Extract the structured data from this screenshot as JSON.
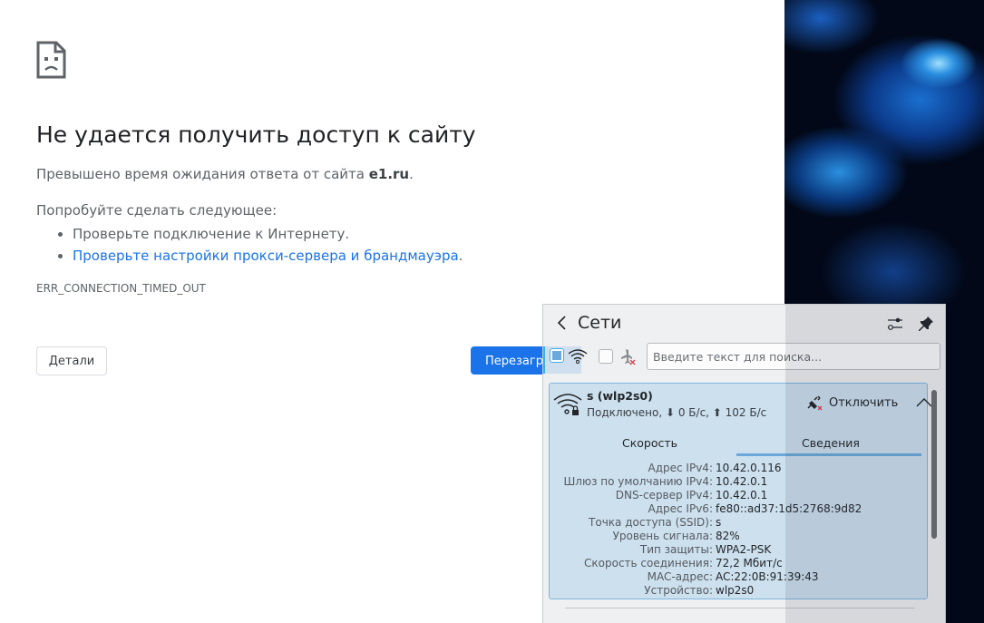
{
  "error_page": {
    "title": "Не удается получить доступ к сайту",
    "message_prefix": "Превышено время ожидания ответа от сайта ",
    "message_host": "e1.ru",
    "message_suffix": ".",
    "try_label": "Попробуйте сделать следующее:",
    "suggestions": [
      "Проверьте подключение к Интернету.",
      "Проверьте настройки прокси-сервера и брандмауэра"
    ],
    "suggestion_suffix": ".",
    "error_code": "ERR_CONNECTION_TIMED_OUT",
    "details_button": "Детали",
    "reload_button": "Перезагрузить"
  },
  "network_panel": {
    "title": "Сети",
    "search_placeholder": "Введите текст для поиска...",
    "wifi_enabled": true,
    "airplane_mode": false,
    "connection": {
      "name": "s (wlp2s0)",
      "status": "Подключено, ⬇ 0 Б/с, ⬆ 102 Б/с",
      "disconnect_label": "Отключить",
      "tabs": [
        "Скорость",
        "Сведения"
      ],
      "active_tab": "Сведения",
      "details": [
        {
          "k": "Адрес IPv4:",
          "v": "10.42.0.116"
        },
        {
          "k": "Шлюз по умолчанию IPv4:",
          "v": "10.42.0.1"
        },
        {
          "k": "DNS-сервер IPv4:",
          "v": "10.42.0.1"
        },
        {
          "k": "Адрес IPv6:",
          "v": "fe80::ad37:1d5:2768:9d82"
        },
        {
          "k": "Точка доступа (SSID):",
          "v": "s"
        },
        {
          "k": "Уровень сигнала:",
          "v": "82%"
        },
        {
          "k": "Тип защиты:",
          "v": "WPA2-PSK"
        },
        {
          "k": "Скорость соединения:",
          "v": "72,2 Мбит/с"
        },
        {
          "k": "MAC-адрес:",
          "v": "AC:22:0B:91:39:43"
        },
        {
          "k": "Устройство:",
          "v": "wlp2s0"
        }
      ]
    }
  }
}
